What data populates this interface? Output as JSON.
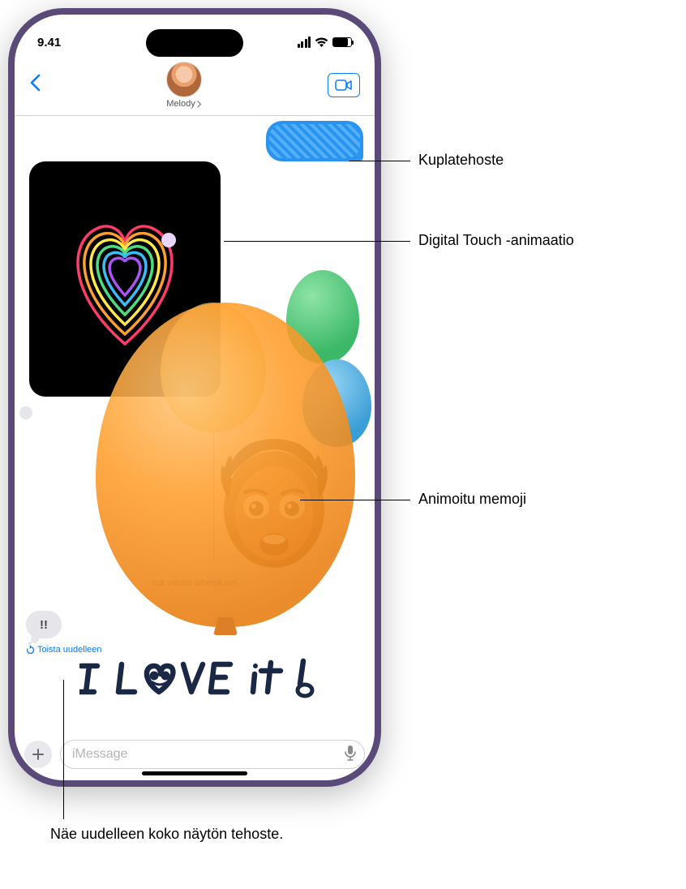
{
  "status": {
    "time": "9.41"
  },
  "nav": {
    "contact_name": "Melody"
  },
  "convo": {
    "sent_caption": "ruit viestin lähetyksen",
    "tapback_symbol": "!!",
    "replay_label": "Toista uudelleen"
  },
  "input": {
    "placeholder": "iMessage"
  },
  "callouts": {
    "bubble_effect": "Kuplatehoste",
    "digital_touch": "Digital Touch -animaatio",
    "memoji": "Animoitu memoji",
    "replay_full": "Näe uudelleen koko näytön tehoste."
  }
}
